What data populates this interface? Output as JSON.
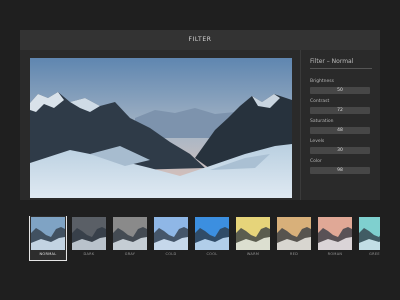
{
  "window": {
    "title": "FILTER"
  },
  "panel": {
    "title": "Filter – Normal",
    "sliders": [
      {
        "label": "Brightness",
        "value": "50"
      },
      {
        "label": "Contrast",
        "value": "72"
      },
      {
        "label": "Saturation",
        "value": "48"
      },
      {
        "label": "Levels",
        "value": "30"
      },
      {
        "label": "Color",
        "value": "98"
      }
    ]
  },
  "filters": [
    {
      "label": "NORMAL",
      "tint": "#7fa3c4",
      "selected": true
    },
    {
      "label": "DARK",
      "tint": "#5a5f66"
    },
    {
      "label": "GRAY",
      "tint": "#8a8a8a"
    },
    {
      "label": "COLD",
      "tint": "#8fb7e6"
    },
    {
      "label": "COOL",
      "tint": "#3d8fe0"
    },
    {
      "label": "WARM",
      "tint": "#e6d47a"
    },
    {
      "label": "RED",
      "tint": "#d9b07a"
    },
    {
      "label": "ROMAN",
      "tint": "#e0a896"
    },
    {
      "label": "GREEN",
      "tint": "#7fd0cf"
    }
  ]
}
